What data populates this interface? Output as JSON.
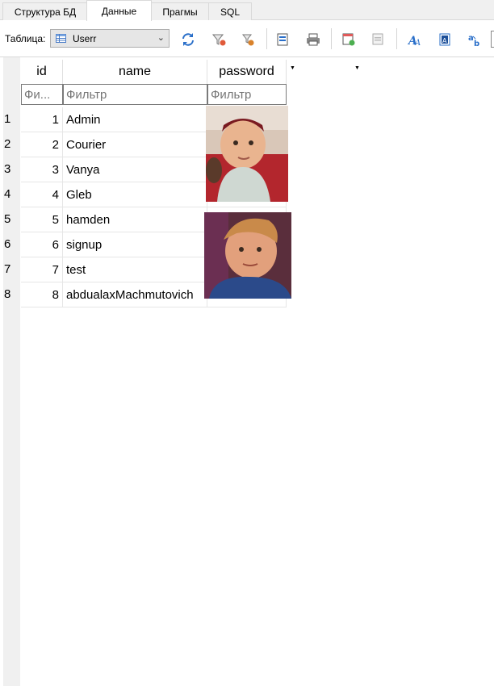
{
  "tabs": [
    {
      "label": "Структура БД",
      "active": false
    },
    {
      "label": "Данные",
      "active": true
    },
    {
      "label": "Прагмы",
      "active": false
    },
    {
      "label": "SQL",
      "active": false
    }
  ],
  "toolbar": {
    "table_label": "Таблица:",
    "table_value": "Userr",
    "icons": [
      "refresh-icon",
      "clear-filter-icon",
      "save-filter-icon",
      "export-icon",
      "print-icon",
      "insert-record-icon",
      "delete-record-icon",
      "font-icon",
      "text-icon",
      "replace-icon"
    ]
  },
  "grid": {
    "columns": [
      "id",
      "name",
      "password"
    ],
    "filter_placeholders": [
      "Фи...",
      "Фильтр",
      "Фильтр"
    ],
    "row_numbers": [
      "1",
      "2",
      "3",
      "4",
      "5",
      "6",
      "7",
      "8"
    ],
    "rows": [
      {
        "id": "1",
        "name": "Admin"
      },
      {
        "id": "2",
        "name": "Courier"
      },
      {
        "id": "3",
        "name": "Vanya"
      },
      {
        "id": "4",
        "name": "Gleb"
      },
      {
        "id": "5",
        "name": "hamden"
      },
      {
        "id": "6",
        "name": "signup"
      },
      {
        "id": "7",
        "name": "test"
      },
      {
        "id": "8",
        "name": "abdualaxMachmutovich"
      }
    ],
    "password_images": [
      "child-photo-red-hat",
      "child-photo-blue-shirt"
    ]
  },
  "colors": {
    "accent": "#2a6fc9",
    "header_bg": "#f0f0f0",
    "combo_bg": "#e6e6e6"
  }
}
